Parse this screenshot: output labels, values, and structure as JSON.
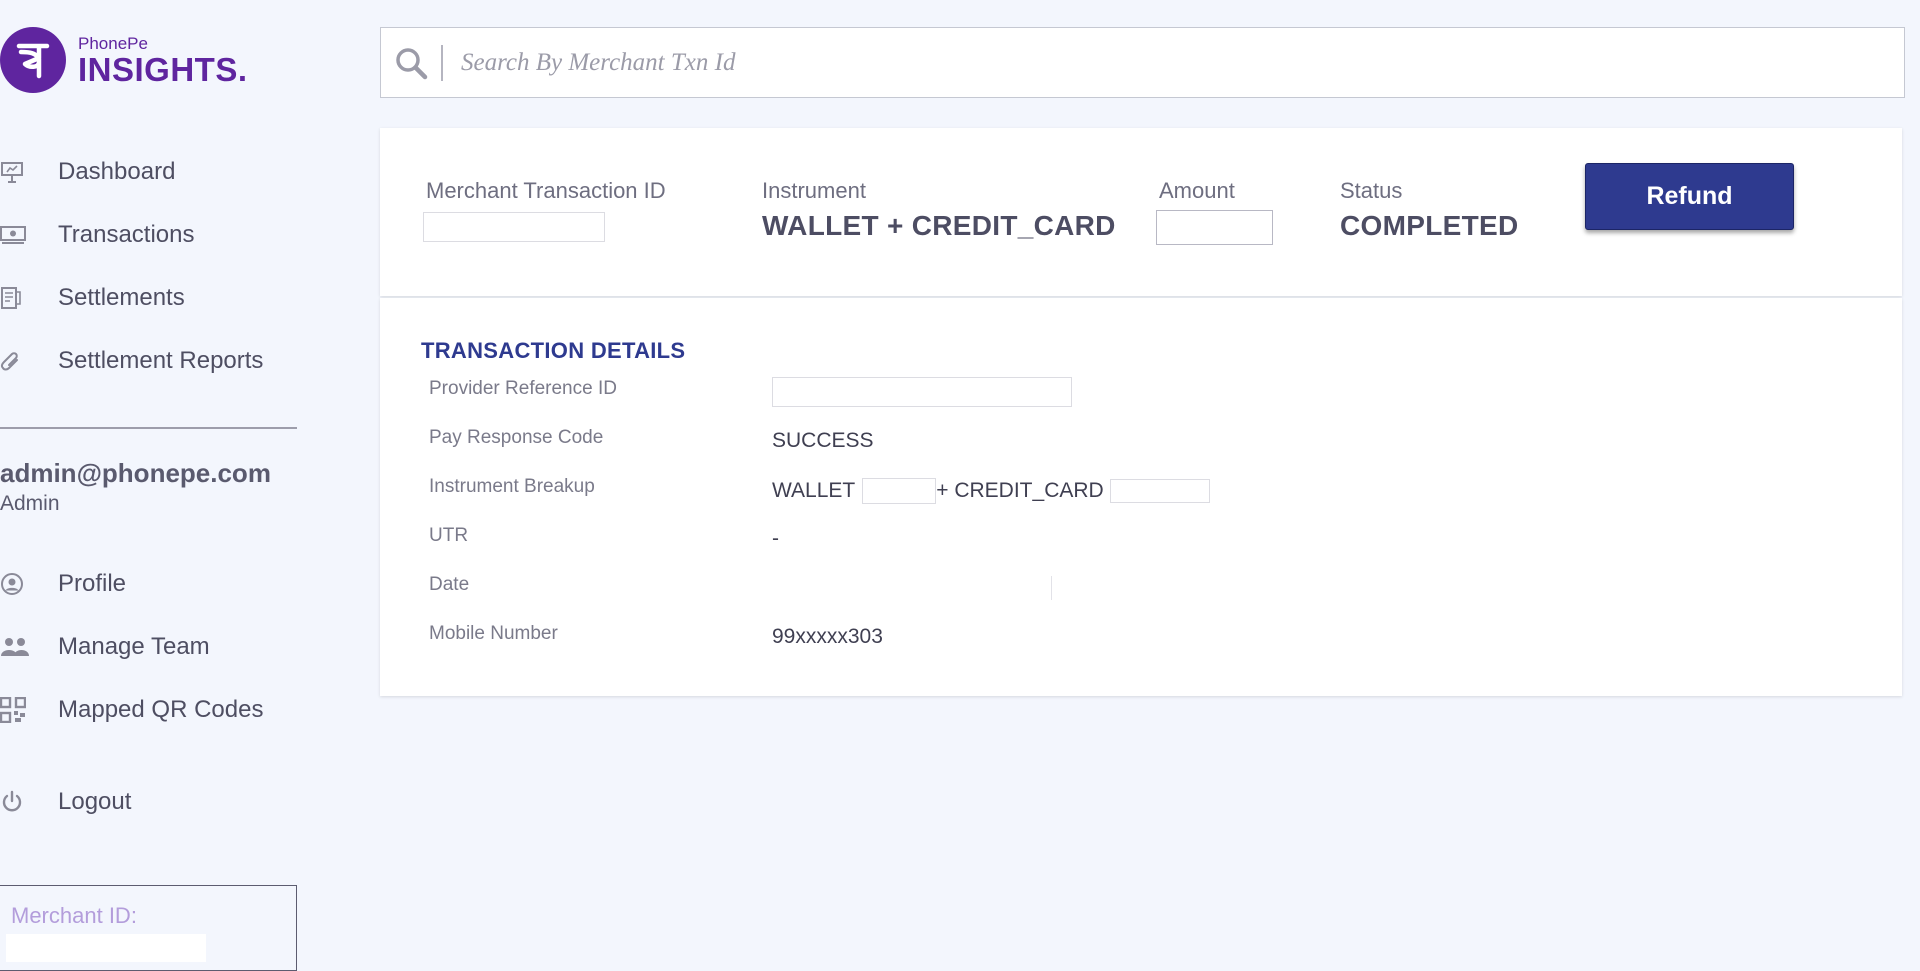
{
  "logo": {
    "brand": "PhonePe",
    "product": "INSIGHTS."
  },
  "nav_primary": [
    {
      "label": "Dashboard",
      "icon": "presentation-icon"
    },
    {
      "label": "Transactions",
      "icon": "money-icon"
    },
    {
      "label": "Settlements",
      "icon": "receipt-icon"
    },
    {
      "label": "Settlement Reports",
      "icon": "paperclip-icon"
    }
  ],
  "user": {
    "email": "admin@phonepe.com",
    "role": "Admin"
  },
  "nav_secondary": [
    {
      "label": "Profile",
      "icon": "user-circle-icon"
    },
    {
      "label": "Manage Team",
      "icon": "team-icon"
    },
    {
      "label": "Mapped QR Codes",
      "icon": "qr-code-icon"
    }
  ],
  "nav_logout": {
    "label": "Logout",
    "icon": "power-icon"
  },
  "merchant": {
    "label": "Merchant ID:",
    "value": ""
  },
  "search": {
    "placeholder": "Search By Merchant Txn Id",
    "value": ""
  },
  "summary": {
    "merchant_txn_label": "Merchant Transaction ID",
    "merchant_txn_value": "",
    "instrument_label": "Instrument",
    "instrument_value": "WALLET + CREDIT_CARD",
    "amount_label": "Amount",
    "amount_value": "",
    "status_label": "Status",
    "status_value": "COMPLETED",
    "refund_label": "Refund"
  },
  "details": {
    "title": "TRANSACTION DETAILS",
    "provider_ref": {
      "label": "Provider Reference ID",
      "value": ""
    },
    "pay_response": {
      "label": "Pay Response Code",
      "value": "SUCCESS"
    },
    "instrument_breakup": {
      "label": "Instrument Breakup",
      "part1": "WALLET",
      "part2": "+ CREDIT_CARD"
    },
    "utr": {
      "label": "UTR",
      "value": "-"
    },
    "date": {
      "label": "Date",
      "value": ""
    },
    "mobile": {
      "label": "Mobile Number",
      "value": "99xxxxx303"
    }
  },
  "colors": {
    "brand": "#5f259f",
    "accent": "#2e3a8f",
    "background": "#f3f6fd"
  }
}
